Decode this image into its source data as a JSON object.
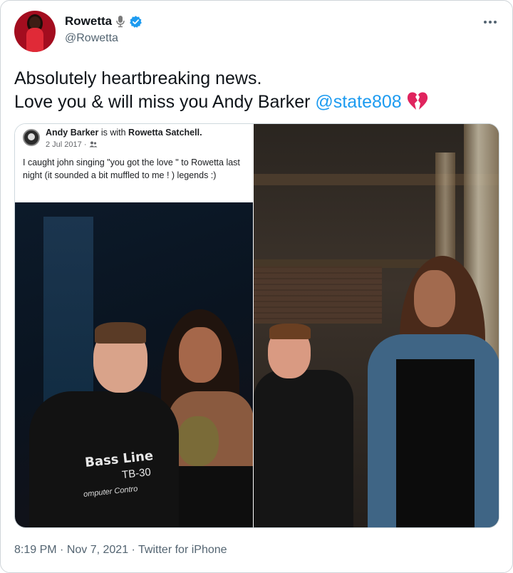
{
  "author": {
    "display_name": "Rowetta",
    "handle": "@Rowetta"
  },
  "tweet": {
    "line1": "Absolutely heartbreaking news.",
    "line2_text": "Love you & will miss you Andy Barker",
    "mention": "@state808"
  },
  "embedded_post": {
    "author": "Andy Barker",
    "with_text": "is with",
    "tagged": "Rowetta Satchell.",
    "date": "2 Jul 2017 ·",
    "body": "I caught john singing \"you got the love \" to Rowetta last night (it sounded a bit muffled to me ! ) legends :)",
    "shirt_line1": "Bass Line",
    "shirt_line2": "TB-30",
    "shirt_line3": "omputer Contro"
  },
  "meta": {
    "time": "8:19 PM",
    "date": "Nov 7, 2021",
    "source": "Twitter for iPhone",
    "separator": " · "
  },
  "colors": {
    "link": "#1d9bf0",
    "secondary_text": "#536471",
    "heart": "#e0245e",
    "verified": "#1d9bf0"
  },
  "icons": [
    "microphone-icon",
    "verified-badge-icon",
    "more-icon",
    "broken-heart-icon",
    "friends-icon"
  ]
}
